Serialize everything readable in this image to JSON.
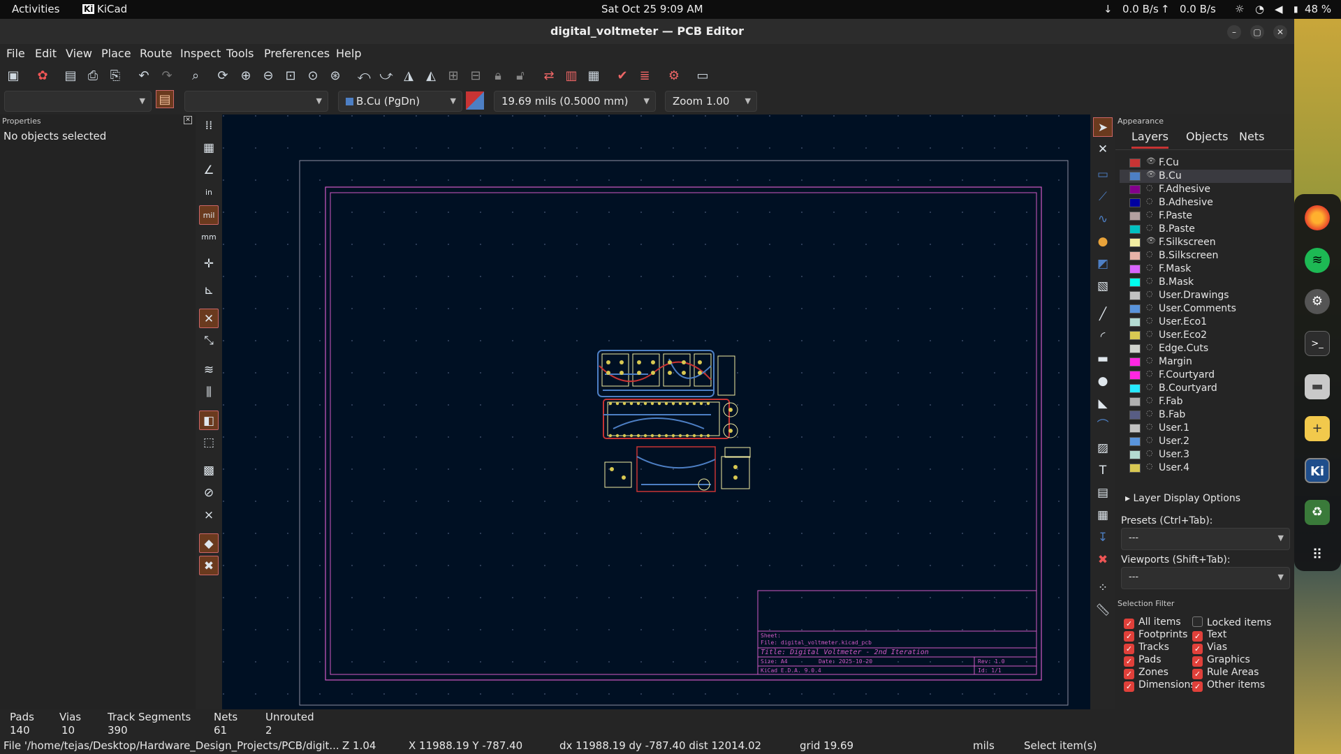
{
  "topbar": {
    "activities": "Activities",
    "app": "KiCad",
    "datetime": "Sat Oct 25  9:09 AM",
    "net_down": "0.0 B/s",
    "net_up": "0.0 B/s",
    "battery": "48 %"
  },
  "window": {
    "title": "digital_voltmeter — PCB Editor"
  },
  "menu": [
    "File",
    "Edit",
    "View",
    "Place",
    "Route",
    "Inspect",
    "Tools",
    "Preferences",
    "Help"
  ],
  "options": {
    "layer": "B.Cu (PgDn)",
    "grid": "19.69 mils (0.5000 mm)",
    "zoom": "Zoom 1.00"
  },
  "properties": {
    "title": "Properties",
    "empty": "No objects selected"
  },
  "appearance": {
    "title": "Appearance",
    "tabs": [
      "Layers",
      "Objects",
      "Nets"
    ],
    "layers": [
      {
        "name": "F.Cu",
        "color": "#c83434",
        "visible": true
      },
      {
        "name": "B.Cu",
        "color": "#4d7fc4",
        "visible": true
      },
      {
        "name": "F.Adhesive",
        "color": "#84008c",
        "visible": false
      },
      {
        "name": "B.Adhesive",
        "color": "#0000a0",
        "visible": false
      },
      {
        "name": "F.Paste",
        "color": "#b4a0a0",
        "visible": false
      },
      {
        "name": "B.Paste",
        "color": "#00c2c2",
        "visible": false
      },
      {
        "name": "F.Silkscreen",
        "color": "#f2eda1",
        "visible": true
      },
      {
        "name": "B.Silkscreen",
        "color": "#e8b2a7",
        "visible": false
      },
      {
        "name": "F.Mask",
        "color": "#d864ff",
        "visible": false
      },
      {
        "name": "B.Mask",
        "color": "#02ffee",
        "visible": false
      },
      {
        "name": "User.Drawings",
        "color": "#c2c2c2",
        "visible": false
      },
      {
        "name": "User.Comments",
        "color": "#5994dc",
        "visible": false
      },
      {
        "name": "User.Eco1",
        "color": "#b4dbd2",
        "visible": false
      },
      {
        "name": "User.Eco2",
        "color": "#d8c852",
        "visible": false
      },
      {
        "name": "Edge.Cuts",
        "color": "#d0d2cd",
        "visible": false
      },
      {
        "name": "Margin",
        "color": "#ff26e2",
        "visible": false
      },
      {
        "name": "F.Courtyard",
        "color": "#ff26e2",
        "visible": false
      },
      {
        "name": "B.Courtyard",
        "color": "#26e9ff",
        "visible": false
      },
      {
        "name": "F.Fab",
        "color": "#afafaf",
        "visible": false
      },
      {
        "name": "B.Fab",
        "color": "#585d84",
        "visible": false
      },
      {
        "name": "User.1",
        "color": "#c2c2c2",
        "visible": false
      },
      {
        "name": "User.2",
        "color": "#5994dc",
        "visible": false
      },
      {
        "name": "User.3",
        "color": "#b4dbd2",
        "visible": false
      },
      {
        "name": "User.4",
        "color": "#d8c852",
        "visible": false
      }
    ],
    "layer_display_options": "Layer Display Options",
    "presets_label": "Presets (Ctrl+Tab):",
    "presets_value": "---",
    "viewports_label": "Viewports (Shift+Tab):",
    "viewports_value": "---",
    "selection_filter": "Selection Filter",
    "filters_left": [
      {
        "label": "All items",
        "checked": true
      },
      {
        "label": "Footprints",
        "checked": true
      },
      {
        "label": "Tracks",
        "checked": true
      },
      {
        "label": "Pads",
        "checked": true
      },
      {
        "label": "Zones",
        "checked": true
      },
      {
        "label": "Dimensions",
        "checked": true
      }
    ],
    "filters_right": [
      {
        "label": "Locked items",
        "checked": false
      },
      {
        "label": "Text",
        "checked": true
      },
      {
        "label": "Vias",
        "checked": true
      },
      {
        "label": "Graphics",
        "checked": true
      },
      {
        "label": "Rule Areas",
        "checked": true
      },
      {
        "label": "Other items",
        "checked": true
      }
    ]
  },
  "stats": {
    "headers": [
      "Pads",
      "Vias",
      "Track Segments",
      "Nets",
      "Unrouted"
    ],
    "values": [
      "140",
      "10",
      "390",
      "61",
      "2"
    ]
  },
  "status": {
    "file": "File '/home/tejas/Desktop/Hardware_Design_Projects/PCB/digit...",
    "z": "Z 1.04",
    "xy": "X 11988.19  Y -787.40",
    "delta": "dx 11988.19  dy -787.40  dist 12014.02",
    "grid": "grid 19.69",
    "units": "mils",
    "mode": "Select item(s)"
  },
  "titleblock": {
    "sheet": "Sheet:",
    "file": "File: digital_voltmeter.kicad_pcb",
    "title": "Title: Digital Voltmeter - 2nd Iteration",
    "size": "Size: A4",
    "date": "Date: 2025-10-20",
    "rev": "Rev: 1.0",
    "kicad": "KiCad E.D.A. 9.0.4",
    "id": "Id: 1/1"
  }
}
